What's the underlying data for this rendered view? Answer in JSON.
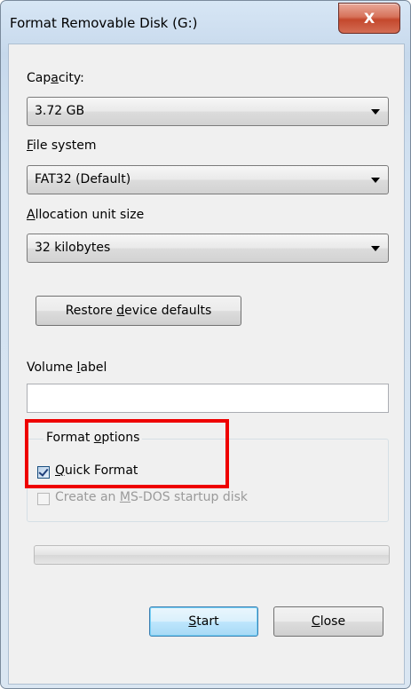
{
  "window": {
    "title": "Format Removable Disk (G:)",
    "close_label": "X"
  },
  "capacity": {
    "label": "Capacity:",
    "value": "3.72 GB"
  },
  "file_system": {
    "label": "File system",
    "value": "FAT32 (Default)"
  },
  "allocation": {
    "label": "Allocation unit size",
    "value": "32 kilobytes"
  },
  "restore_button": "Restore device defaults",
  "volume": {
    "label": "Volume label",
    "value": ""
  },
  "format_options": {
    "title": "Format options",
    "quick_format": {
      "label": "Quick Format",
      "checked": true
    },
    "msdos": {
      "label": "Create an MS-DOS startup disk",
      "checked": false,
      "enabled": false
    }
  },
  "progress": {
    "value": 0
  },
  "buttons": {
    "start": "Start",
    "close": "Close"
  },
  "colors": {
    "highlight": "#ee0000",
    "titlebar": "#c7d9ec",
    "close_button": "#c4482d",
    "default_button_border": "#3c7fb1"
  }
}
